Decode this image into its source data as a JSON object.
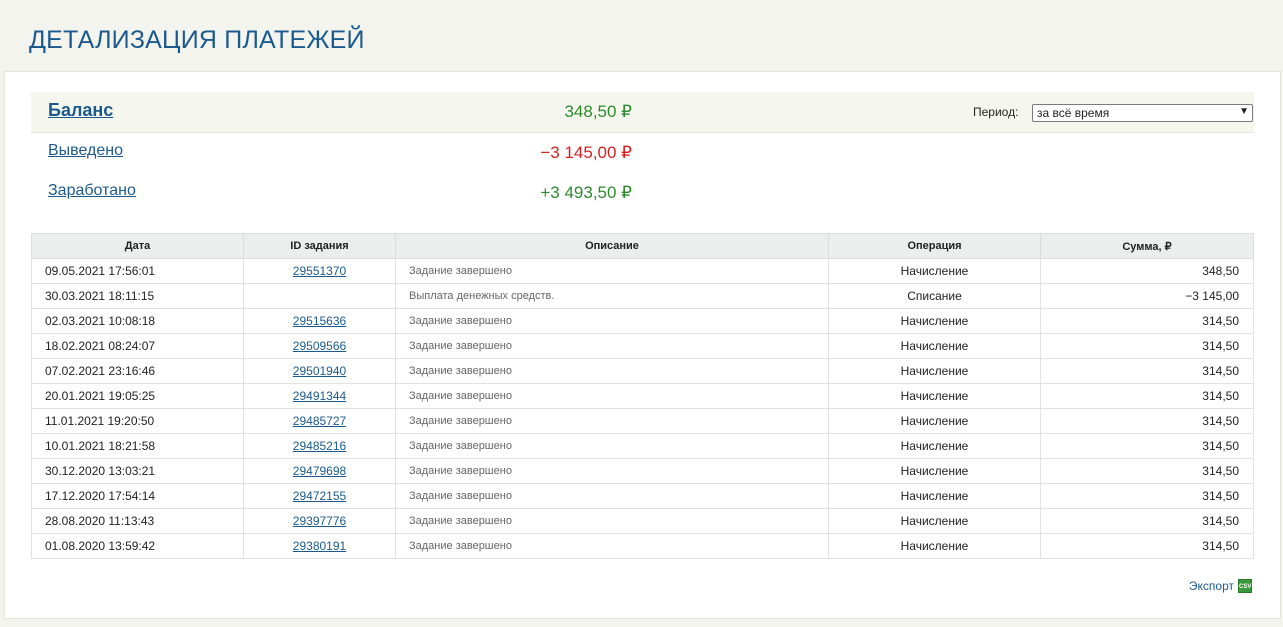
{
  "page_title": "ДЕТАЛИЗАЦИЯ ПЛАТЕЖЕЙ",
  "summary": {
    "balance": {
      "label": "Баланс",
      "value": "348,50 ₽"
    },
    "withdrawn": {
      "label": "Выведено",
      "value": "−3 145,00 ₽"
    },
    "earned": {
      "label": "Заработано",
      "value": "+3 493,50 ₽"
    }
  },
  "period": {
    "label": "Период:",
    "selected": "за всё время"
  },
  "table": {
    "headers": [
      "Дата",
      "ID задания",
      "Описание",
      "Операция",
      "Сумма, ₽"
    ],
    "rows": [
      {
        "date": "09.05.2021 17:56:01",
        "id": "29551370",
        "desc": "Задание завершено",
        "op": "Начисление",
        "sum": "348,50"
      },
      {
        "date": "30.03.2021 18:11:15",
        "id": "",
        "desc": "Выплата денежных средств.",
        "op": "Списание",
        "sum": "−3 145,00"
      },
      {
        "date": "02.03.2021 10:08:18",
        "id": "29515636",
        "desc": "Задание завершено",
        "op": "Начисление",
        "sum": "314,50"
      },
      {
        "date": "18.02.2021 08:24:07",
        "id": "29509566",
        "desc": "Задание завершено",
        "op": "Начисление",
        "sum": "314,50"
      },
      {
        "date": "07.02.2021 23:16:46",
        "id": "29501940",
        "desc": "Задание завершено",
        "op": "Начисление",
        "sum": "314,50"
      },
      {
        "date": "20.01.2021 19:05:25",
        "id": "29491344",
        "desc": "Задание завершено",
        "op": "Начисление",
        "sum": "314,50"
      },
      {
        "date": "11.01.2021 19:20:50",
        "id": "29485727",
        "desc": "Задание завершено",
        "op": "Начисление",
        "sum": "314,50"
      },
      {
        "date": "10.01.2021 18:21:58",
        "id": "29485216",
        "desc": "Задание завершено",
        "op": "Начисление",
        "sum": "314,50"
      },
      {
        "date": "30.12.2020 13:03:21",
        "id": "29479698",
        "desc": "Задание завершено",
        "op": "Начисление",
        "sum": "314,50"
      },
      {
        "date": "17.12.2020 17:54:14",
        "id": "29472155",
        "desc": "Задание завершено",
        "op": "Начисление",
        "sum": "314,50"
      },
      {
        "date": "28.08.2020 11:13:43",
        "id": "29397776",
        "desc": "Задание завершено",
        "op": "Начисление",
        "sum": "314,50"
      },
      {
        "date": "01.08.2020 13:59:42",
        "id": "29380191",
        "desc": "Задание завершено",
        "op": "Начисление",
        "sum": "314,50"
      }
    ]
  },
  "export": {
    "label": "Экспорт",
    "icon_text": "CSV",
    "icon": "csv-file-icon"
  },
  "colors": {
    "title": "#1c5a8e",
    "positive": "#2e8a2e",
    "negative": "#d62020"
  }
}
